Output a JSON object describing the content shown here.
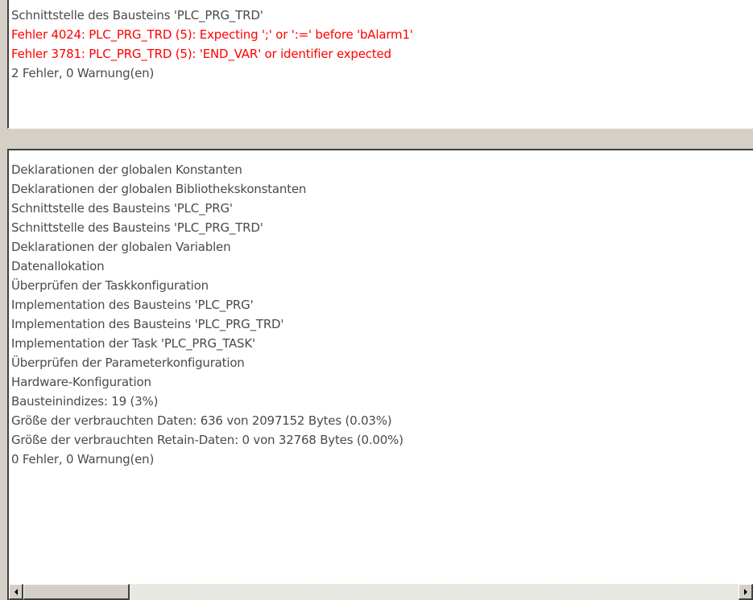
{
  "messages_top": [
    {
      "text": "Schnittstelle des Bausteins 'PLC_PRG_TRD'",
      "type": "info"
    },
    {
      "text": "Fehler 4024: PLC_PRG_TRD (5): Expecting ';' or ':=' before 'bAlarm1'",
      "type": "error"
    },
    {
      "text": "Fehler 3781: PLC_PRG_TRD (5): 'END_VAR' or identifier expected",
      "type": "error"
    },
    {
      "text": "2 Fehler, 0 Warnung(en)",
      "type": "info"
    }
  ],
  "messages_bottom": [
    {
      "text": "Deklarationen der globalen Konstanten"
    },
    {
      "text": "Deklarationen der globalen Bibliothekskonstanten"
    },
    {
      "text": "Schnittstelle des Bausteins 'PLC_PRG'"
    },
    {
      "text": "Schnittstelle des Bausteins 'PLC_PRG_TRD'"
    },
    {
      "text": "Deklarationen der globalen Variablen"
    },
    {
      "text": "Datenallokation"
    },
    {
      "text": "Überprüfen der Taskkonfiguration"
    },
    {
      "text": "Implementation des Bausteins 'PLC_PRG'"
    },
    {
      "text": "Implementation des Bausteins 'PLC_PRG_TRD'"
    },
    {
      "text": "Implementation der Task 'PLC_PRG_TASK'"
    },
    {
      "text": "Überprüfen der Parameterkonfiguration"
    },
    {
      "text": "Hardware-Konfiguration"
    },
    {
      "text": "Bausteinindizes: 19 (3%)"
    },
    {
      "text": "Größe der verbrauchten Daten: 636 von 2097152 Bytes (0.03%)"
    },
    {
      "text": "Größe der verbrauchten Retain-Daten: 0 von 32768 Bytes (0.00%)"
    },
    {
      "text": "0 Fehler, 0 Warnung(en)"
    }
  ],
  "scrollbar": {
    "left_icon": "scroll-left-arrow",
    "right_icon": "scroll-right-arrow"
  },
  "colors": {
    "error": "#ff0000",
    "text": "#4a4a4a",
    "background": "#ffffff",
    "chrome": "#d4d0c8"
  }
}
